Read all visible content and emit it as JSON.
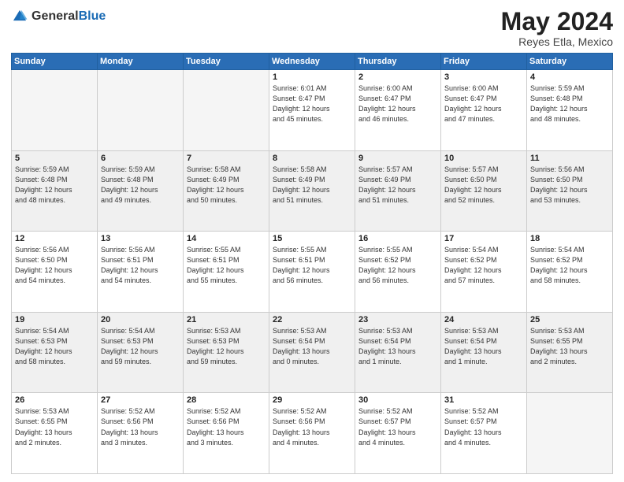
{
  "header": {
    "logo_general": "General",
    "logo_blue": "Blue",
    "title": "May 2024",
    "location": "Reyes Etla, Mexico"
  },
  "days_of_week": [
    "Sunday",
    "Monday",
    "Tuesday",
    "Wednesday",
    "Thursday",
    "Friday",
    "Saturday"
  ],
  "weeks": [
    [
      {
        "day": "",
        "info": "",
        "empty": true
      },
      {
        "day": "",
        "info": "",
        "empty": true
      },
      {
        "day": "",
        "info": "",
        "empty": true
      },
      {
        "day": "1",
        "info": "Sunrise: 6:01 AM\nSunset: 6:47 PM\nDaylight: 12 hours\nand 45 minutes."
      },
      {
        "day": "2",
        "info": "Sunrise: 6:00 AM\nSunset: 6:47 PM\nDaylight: 12 hours\nand 46 minutes."
      },
      {
        "day": "3",
        "info": "Sunrise: 6:00 AM\nSunset: 6:47 PM\nDaylight: 12 hours\nand 47 minutes."
      },
      {
        "day": "4",
        "info": "Sunrise: 5:59 AM\nSunset: 6:48 PM\nDaylight: 12 hours\nand 48 minutes."
      }
    ],
    [
      {
        "day": "5",
        "info": "Sunrise: 5:59 AM\nSunset: 6:48 PM\nDaylight: 12 hours\nand 48 minutes."
      },
      {
        "day": "6",
        "info": "Sunrise: 5:59 AM\nSunset: 6:48 PM\nDaylight: 12 hours\nand 49 minutes."
      },
      {
        "day": "7",
        "info": "Sunrise: 5:58 AM\nSunset: 6:49 PM\nDaylight: 12 hours\nand 50 minutes."
      },
      {
        "day": "8",
        "info": "Sunrise: 5:58 AM\nSunset: 6:49 PM\nDaylight: 12 hours\nand 51 minutes."
      },
      {
        "day": "9",
        "info": "Sunrise: 5:57 AM\nSunset: 6:49 PM\nDaylight: 12 hours\nand 51 minutes."
      },
      {
        "day": "10",
        "info": "Sunrise: 5:57 AM\nSunset: 6:50 PM\nDaylight: 12 hours\nand 52 minutes."
      },
      {
        "day": "11",
        "info": "Sunrise: 5:56 AM\nSunset: 6:50 PM\nDaylight: 12 hours\nand 53 minutes."
      }
    ],
    [
      {
        "day": "12",
        "info": "Sunrise: 5:56 AM\nSunset: 6:50 PM\nDaylight: 12 hours\nand 54 minutes."
      },
      {
        "day": "13",
        "info": "Sunrise: 5:56 AM\nSunset: 6:51 PM\nDaylight: 12 hours\nand 54 minutes."
      },
      {
        "day": "14",
        "info": "Sunrise: 5:55 AM\nSunset: 6:51 PM\nDaylight: 12 hours\nand 55 minutes."
      },
      {
        "day": "15",
        "info": "Sunrise: 5:55 AM\nSunset: 6:51 PM\nDaylight: 12 hours\nand 56 minutes."
      },
      {
        "day": "16",
        "info": "Sunrise: 5:55 AM\nSunset: 6:52 PM\nDaylight: 12 hours\nand 56 minutes."
      },
      {
        "day": "17",
        "info": "Sunrise: 5:54 AM\nSunset: 6:52 PM\nDaylight: 12 hours\nand 57 minutes."
      },
      {
        "day": "18",
        "info": "Sunrise: 5:54 AM\nSunset: 6:52 PM\nDaylight: 12 hours\nand 58 minutes."
      }
    ],
    [
      {
        "day": "19",
        "info": "Sunrise: 5:54 AM\nSunset: 6:53 PM\nDaylight: 12 hours\nand 58 minutes."
      },
      {
        "day": "20",
        "info": "Sunrise: 5:54 AM\nSunset: 6:53 PM\nDaylight: 12 hours\nand 59 minutes."
      },
      {
        "day": "21",
        "info": "Sunrise: 5:53 AM\nSunset: 6:53 PM\nDaylight: 12 hours\nand 59 minutes."
      },
      {
        "day": "22",
        "info": "Sunrise: 5:53 AM\nSunset: 6:54 PM\nDaylight: 13 hours\nand 0 minutes."
      },
      {
        "day": "23",
        "info": "Sunrise: 5:53 AM\nSunset: 6:54 PM\nDaylight: 13 hours\nand 1 minute."
      },
      {
        "day": "24",
        "info": "Sunrise: 5:53 AM\nSunset: 6:54 PM\nDaylight: 13 hours\nand 1 minute."
      },
      {
        "day": "25",
        "info": "Sunrise: 5:53 AM\nSunset: 6:55 PM\nDaylight: 13 hours\nand 2 minutes."
      }
    ],
    [
      {
        "day": "26",
        "info": "Sunrise: 5:53 AM\nSunset: 6:55 PM\nDaylight: 13 hours\nand 2 minutes."
      },
      {
        "day": "27",
        "info": "Sunrise: 5:52 AM\nSunset: 6:56 PM\nDaylight: 13 hours\nand 3 minutes."
      },
      {
        "day": "28",
        "info": "Sunrise: 5:52 AM\nSunset: 6:56 PM\nDaylight: 13 hours\nand 3 minutes."
      },
      {
        "day": "29",
        "info": "Sunrise: 5:52 AM\nSunset: 6:56 PM\nDaylight: 13 hours\nand 4 minutes."
      },
      {
        "day": "30",
        "info": "Sunrise: 5:52 AM\nSunset: 6:57 PM\nDaylight: 13 hours\nand 4 minutes."
      },
      {
        "day": "31",
        "info": "Sunrise: 5:52 AM\nSunset: 6:57 PM\nDaylight: 13 hours\nand 4 minutes."
      },
      {
        "day": "",
        "info": "",
        "empty": true
      }
    ]
  ]
}
